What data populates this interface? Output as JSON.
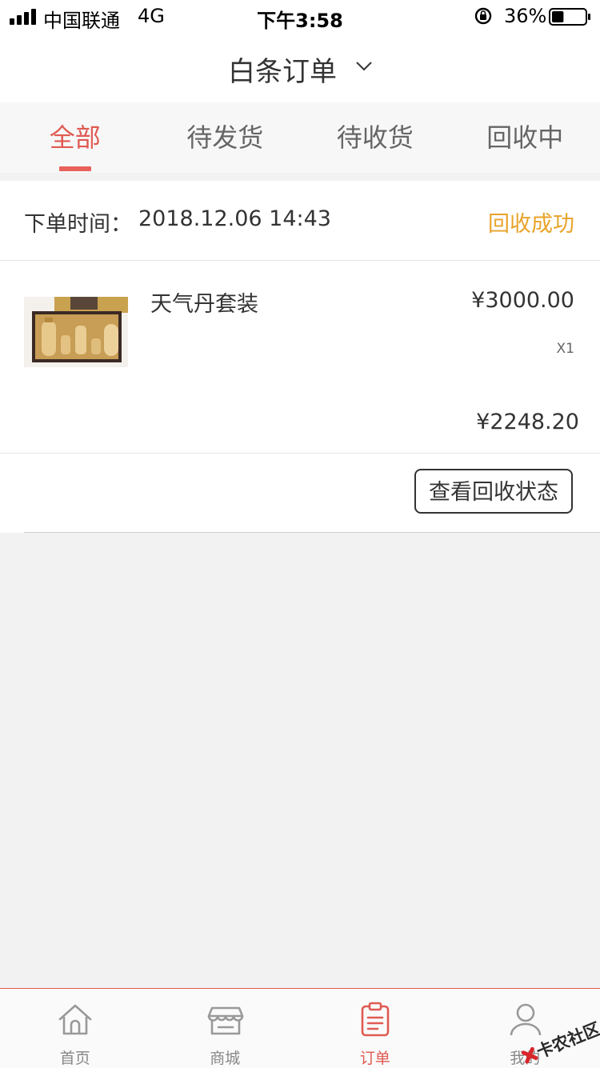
{
  "status_bar": {
    "carrier": "中国联通",
    "network": "4G",
    "time": "下午3:58",
    "battery": "36%",
    "battery_level": 0.36
  },
  "header": {
    "title": "白条订单",
    "dropdown_icon": "chevron-down-icon"
  },
  "tabs": [
    {
      "label": "全部",
      "active": true
    },
    {
      "label": "待发货",
      "active": false
    },
    {
      "label": "待收货",
      "active": false
    },
    {
      "label": "回收中",
      "active": false
    }
  ],
  "order": {
    "time_label": "下单时间：",
    "time": "2018.12.06 14:43",
    "status": "回收成功",
    "product": {
      "name": "天气丹套装",
      "price": "¥3000.00",
      "quantity": "X1"
    },
    "total": "¥2248.20",
    "action_label": "查看回收状态"
  },
  "bottom_nav": [
    {
      "label": "首页",
      "icon": "home-icon",
      "active": false
    },
    {
      "label": "商城",
      "icon": "store-icon",
      "active": false
    },
    {
      "label": "订单",
      "icon": "order-icon",
      "active": true
    },
    {
      "label": "我的",
      "icon": "user-icon",
      "active": false
    }
  ],
  "watermark": "卡农社区",
  "colors": {
    "accent": "#e05a52",
    "status_success": "#e8a329",
    "background": "#f2f2f3"
  }
}
